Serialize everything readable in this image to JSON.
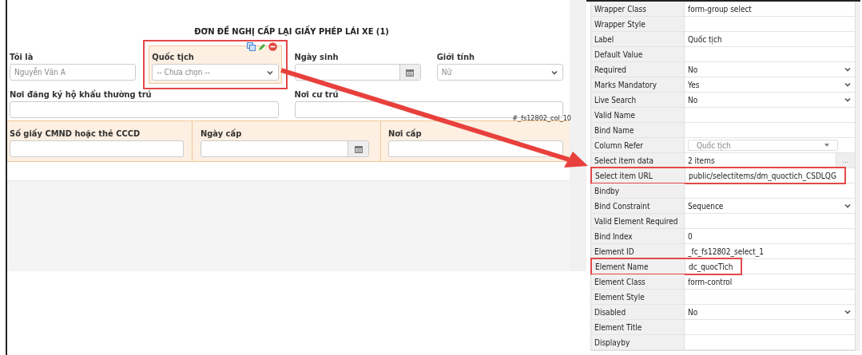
{
  "form": {
    "title": "ĐƠN ĐỀ NGHỊ CẤP LẠI GIẤY PHÉP LÁI XE (1)",
    "rows": [
      {
        "kind": "plain",
        "fields": [
          {
            "label": "Tôi là",
            "kind": "text",
            "placeholder": "Nguyễn Văn A",
            "selected": false,
            "highlighted": false
          },
          {
            "label": "Quốc tịch",
            "kind": "select",
            "value": "-- Chưa chọn --",
            "selected": true,
            "highlighted": true
          },
          {
            "label": "Ngày sinh",
            "kind": "date",
            "selected": false,
            "highlighted": false
          },
          {
            "label": "Giới tính",
            "kind": "select",
            "value": "Nữ",
            "selected": false,
            "highlighted": false
          }
        ]
      },
      {
        "kind": "plain",
        "fields": [
          {
            "label": "Nơi đăng ký hộ khẩu thường trú",
            "kind": "text",
            "selected": false,
            "highlighted": false
          },
          {
            "label": "Nơi cư trú",
            "kind": "text",
            "selected": false,
            "highlighted": false
          }
        ]
      },
      {
        "kind": "section",
        "tag": "#_fs12802_col_10",
        "fields": [
          {
            "label": "Số giấy CMND hoặc thẻ CCCD",
            "kind": "text",
            "selected": false,
            "highlighted": false
          },
          {
            "label": "Ngày cấp",
            "kind": "date",
            "selected": false,
            "highlighted": false
          },
          {
            "label": "Nơi cấp",
            "kind": "text",
            "selected": false,
            "highlighted": false
          }
        ]
      }
    ]
  },
  "properties": {
    "rows": [
      {
        "label": "Wrapper Class",
        "kind": "text",
        "value": "form-group select",
        "highlighted": false
      },
      {
        "label": "Wrapper Style",
        "kind": "text",
        "highlighted": false
      },
      {
        "label": "Label",
        "kind": "text",
        "value": "Quốc tịch",
        "highlighted": false
      },
      {
        "label": "Default Value",
        "kind": "text",
        "highlighted": false
      },
      {
        "label": "Required",
        "kind": "select",
        "value": "No",
        "highlighted": false
      },
      {
        "label": "Marks Mandatory",
        "kind": "select",
        "value": "Yes",
        "highlighted": false
      },
      {
        "label": "Live Search",
        "kind": "select",
        "value": "No",
        "highlighted": false
      },
      {
        "label": "Valid Name",
        "kind": "text",
        "highlighted": false
      },
      {
        "label": "Bind Name",
        "kind": "text",
        "highlighted": false
      },
      {
        "label": "Column Refer",
        "kind": "combo",
        "value": "Quốc tịch",
        "highlighted": false
      },
      {
        "label": "Select item data",
        "kind": "items",
        "value": "2 items",
        "button": "...",
        "highlighted": false
      },
      {
        "label": "Select item URL",
        "kind": "text",
        "value": "public/selectitems/dm_quoctich_CSDLQG",
        "highlighted": true
      },
      {
        "label": "Bindby",
        "kind": "text",
        "highlighted": false
      },
      {
        "label": "Bind Constraint",
        "kind": "select",
        "value": "Sequence",
        "highlighted": false
      },
      {
        "label": "Valid Element Required",
        "kind": "text",
        "highlighted": false
      },
      {
        "label": "Bind Index",
        "kind": "text",
        "value": "0",
        "highlighted": false
      },
      {
        "label": "Element ID",
        "kind": "text",
        "value": "_fc_fs12802_select_1",
        "highlighted": false
      },
      {
        "label": "Element Name",
        "kind": "text",
        "value": "dc_quocTich",
        "highlighted": true
      },
      {
        "label": "Element Class",
        "kind": "text",
        "value": "form-control",
        "highlighted": false
      },
      {
        "label": "Element Style",
        "kind": "text",
        "highlighted": false
      },
      {
        "label": "Disabled",
        "kind": "select",
        "value": "No",
        "highlighted": false
      },
      {
        "label": "Element Title",
        "kind": "text",
        "highlighted": false
      },
      {
        "label": "Displayby",
        "kind": "text",
        "highlighted": false
      }
    ]
  }
}
